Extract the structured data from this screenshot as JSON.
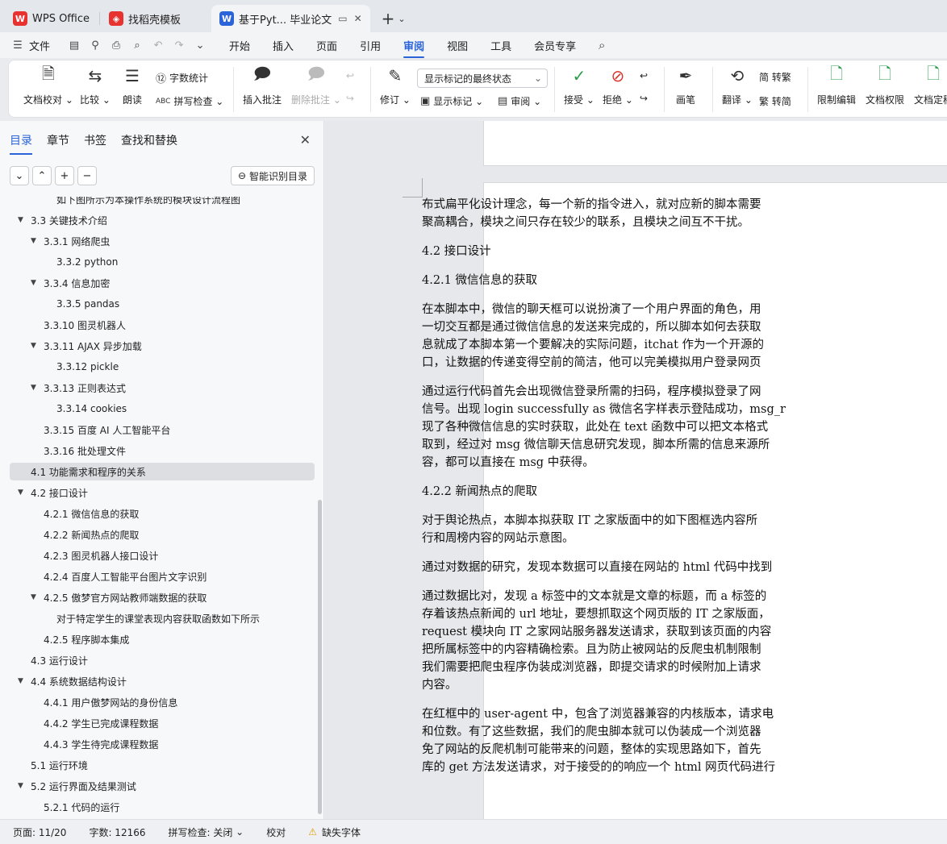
{
  "tabs": [
    {
      "label": "WPS Office",
      "icon": "wps-logo-icon"
    },
    {
      "label": "找稻壳模板",
      "icon": "docer-icon"
    },
    {
      "label": "基于Pyt... 毕业论文",
      "icon": "writer-doc-icon"
    }
  ],
  "menu": {
    "file_label": "文件",
    "tabs": [
      "开始",
      "插入",
      "页面",
      "引用",
      "审阅",
      "视图",
      "工具",
      "会员专享"
    ],
    "active_tab": "审阅"
  },
  "ribbon": {
    "doc_proofread": "文档校对",
    "compare": "比较",
    "read_aloud": "朗读",
    "word_count": "字数统计",
    "spell_check": "拼写检查",
    "insert_comment": "插入批注",
    "delete_comment": "删除批注",
    "revise": "修订",
    "markup_state": "显示标记的最终状态",
    "show_markup": "显示标记",
    "review_pane": "审阅",
    "accept": "接受",
    "reject": "拒绝",
    "pen": "画笔",
    "translate": "翻译",
    "to_traditional": "简 转繁",
    "to_simplified": "繁 转简",
    "restrict_edit": "限制编辑",
    "doc_permission": "文档权限",
    "doc_finalize": "文档定稿"
  },
  "nav": {
    "tabs": [
      "目录",
      "章节",
      "书签",
      "查找和替换"
    ],
    "smart_toc": "智能识别目录",
    "toc": [
      {
        "label": "如下图所示为本操作系统的模块设计流程图",
        "level": 3,
        "tri": false
      },
      {
        "label": "3.3  关键技术介绍",
        "level": 1,
        "tri": true
      },
      {
        "label": "3.3.1 网络爬虫",
        "level": 2,
        "tri": true
      },
      {
        "label": "3.3.2 python",
        "level": 3,
        "tri": false
      },
      {
        "label": "3.3.4 信息加密",
        "level": 2,
        "tri": true
      },
      {
        "label": "3.3.5 pandas",
        "level": 3,
        "tri": false
      },
      {
        "label": "3.3.10 图灵机器人",
        "level": 2,
        "tri": false
      },
      {
        "label": "3.3.11 AJAX 异步加载",
        "level": 2,
        "tri": true
      },
      {
        "label": "3.3.12 pickle",
        "level": 3,
        "tri": false
      },
      {
        "label": "3.3.13  正则表达式",
        "level": 2,
        "tri": true
      },
      {
        "label": "3.3.14 cookies",
        "level": 3,
        "tri": false
      },
      {
        "label": "3.3.15 百度 AI 人工智能平台",
        "level": 2,
        "tri": false
      },
      {
        "label": "3.3.16  批处理文件",
        "level": 2,
        "tri": false
      },
      {
        "label": "4.1 功能需求和程序的关系",
        "level": 1,
        "tri": false,
        "selected": true
      },
      {
        "label": "4.2 接口设计",
        "level": 1,
        "tri": true
      },
      {
        "label": "4.2.1 微信信息的获取",
        "level": 2,
        "tri": false
      },
      {
        "label": "4.2.2 新闻热点的爬取",
        "level": 2,
        "tri": false
      },
      {
        "label": "4.2.3 图灵机器人接口设计",
        "level": 2,
        "tri": false
      },
      {
        "label": "4.2.4  百度人工智能平台图片文字识别",
        "level": 2,
        "tri": false
      },
      {
        "label": "4.2.5 傲梦官方网站教师端数据的获取",
        "level": 2,
        "tri": true
      },
      {
        "label": "对于特定学生的课堂表现内容获取函数如下所示",
        "level": 3,
        "tri": false
      },
      {
        "label": "4.2.5  程序脚本集成",
        "level": 2,
        "tri": false
      },
      {
        "label": "4.3 运行设计",
        "level": 1,
        "tri": false
      },
      {
        "label": "4.4 系统数据结构设计",
        "level": 1,
        "tri": true
      },
      {
        "label": "4.4.1  用户傲梦网站的身份信息",
        "level": 2,
        "tri": false
      },
      {
        "label": "4.4.2  学生已完成课程数据",
        "level": 2,
        "tri": false
      },
      {
        "label": "4.4.3 学生待完成课程数据",
        "level": 2,
        "tri": false
      },
      {
        "label": "5.1  运行环境",
        "level": 1,
        "tri": false
      },
      {
        "label": "5.2 运行界面及结果测试",
        "level": 1,
        "tri": true
      },
      {
        "label": "5.2.1 代码的运行",
        "level": 2,
        "tri": false
      }
    ]
  },
  "document": {
    "blocks": [
      {
        "type": "p",
        "lines": [
          "布式扁平化设计理念，每一个新的指令进入，就对应新的脚本需要",
          "聚高耦合，模块之间只存在较少的联系，且模块之间互不干扰。"
        ]
      },
      {
        "type": "h",
        "lines": [
          "4.2 接口设计"
        ]
      },
      {
        "type": "h",
        "lines": [
          "4.2.1 微信信息的获取"
        ]
      },
      {
        "type": "p",
        "lines": [
          "在本脚本中，微信的聊天框可以说扮演了一个用户界面的角色，用",
          "一切交互都是通过微信信息的发送来完成的，所以脚本如何去获取",
          "息就成了本脚本第一个要解决的实际问题，itchat 作为一个开源的",
          "口，让数据的传递变得空前的简洁，他可以完美模拟用户登录网页"
        ]
      },
      {
        "type": "p",
        "lines": [
          "通过运行代码首先会出现微信登录所需的扫码，程序模拟登录了网",
          "信号。出现 login successfully as  微信名字样表示登陆成功，msg_r",
          "现了各种微信信息的实时获取，此处在 text 函数中可以把文本格式",
          "取到，经过对 msg 微信聊天信息研究发现，脚本所需的信息来源所",
          "容，都可以直接在 msg 中获得。"
        ]
      },
      {
        "type": "h",
        "lines": [
          "4.2.2 新闻热点的爬取"
        ]
      },
      {
        "type": "p",
        "lines": [
          "对于舆论热点，本脚本拟获取 IT 之家版面中的如下图框选内容所",
          "行和周榜内容的网站示意图。"
        ]
      },
      {
        "type": "p",
        "lines": [
          "通过对数据的研究，发现本数据可以直接在网站的 html 代码中找到"
        ]
      },
      {
        "type": "p",
        "lines": [
          "通过数据比对，发现 a 标签中的文本就是文章的标题，而 a 标签的",
          "存着该热点新闻的 url 地址，要想抓取这个网页版的 IT 之家版面，",
          "request 模块向 IT 之家网站服务器发送请求，获取到该页面的内容",
          "把所属标签中的内容精确检索。且为防止被网站的反爬虫机制限制",
          "我们需要把爬虫程序伪装成浏览器，即提交请求的时候附加上请求",
          "内容。"
        ]
      },
      {
        "type": "p",
        "lines": [
          "在红框中的 user-agent 中，包含了浏览器兼容的内核版本，请求电",
          "和位数。有了这些数据，我们的爬虫脚本就可以伪装成一个浏览器",
          "免了网站的反爬机制可能带来的问题，整体的实现思路如下，首先",
          "库的 get 方法发送请求，对于接受的的响应一个 html 网页代码进行"
        ]
      }
    ]
  },
  "status": {
    "page": "页面: 11/20",
    "words": "字数: 12166",
    "spell": "拼写检查: 关闭",
    "proof": "校对",
    "missing_font": "缺失字体"
  },
  "colors": {
    "accent": "#2b64d8",
    "wps_red": "#e8322f",
    "writer_blue": "#2b64d8"
  }
}
